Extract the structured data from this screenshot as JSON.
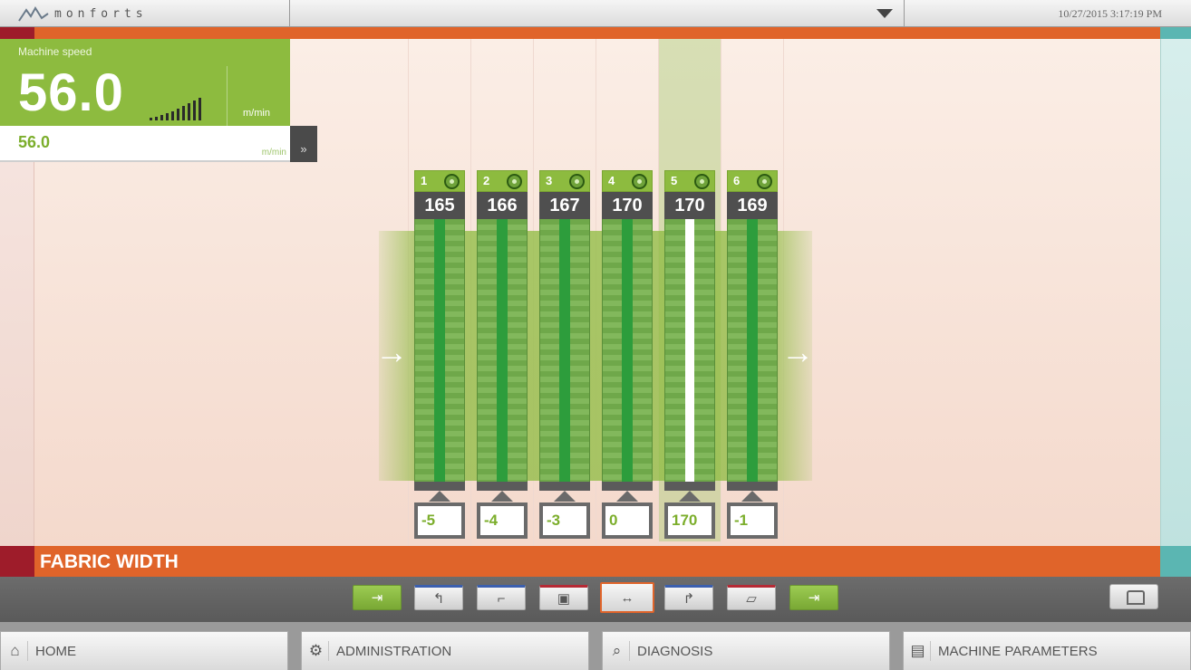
{
  "header": {
    "brand": "monforts",
    "datetime": "10/27/2015 3:17:19 PM"
  },
  "speed": {
    "label": "Machine speed",
    "value": "56.0",
    "unit": "m/min",
    "setpoint": "56.0",
    "setpoint_unit": "m/min",
    "go_label": "»"
  },
  "zones": [
    {
      "num": "1",
      "temp": "165",
      "offset": "-5",
      "active": false
    },
    {
      "num": "2",
      "temp": "166",
      "offset": "-4",
      "active": false
    },
    {
      "num": "3",
      "temp": "167",
      "offset": "-3",
      "active": false
    },
    {
      "num": "4",
      "temp": "170",
      "offset": "0",
      "active": false
    },
    {
      "num": "5",
      "temp": "170",
      "offset": "170",
      "active": true
    },
    {
      "num": "6",
      "temp": "169",
      "offset": "-1",
      "active": false
    }
  ],
  "section": {
    "title": "FABRIC WIDTH"
  },
  "toolbar": [
    {
      "icon": "⇥",
      "style": "green"
    },
    {
      "icon": "↰",
      "style": "grey blue-top"
    },
    {
      "icon": "⌐",
      "style": "grey blue-top"
    },
    {
      "icon": "▣",
      "style": "grey red-top"
    },
    {
      "icon": "↔",
      "style": "grey selected"
    },
    {
      "icon": "↱",
      "style": "grey blue-top"
    },
    {
      "icon": "▱",
      "style": "grey red-top"
    },
    {
      "icon": "⇥",
      "style": "green"
    }
  ],
  "nav": [
    {
      "label": "HOME",
      "icon": "⌂"
    },
    {
      "label": "ADMINISTRATION",
      "icon": "⚙"
    },
    {
      "label": "DIAGNOSIS",
      "icon": "⌕"
    },
    {
      "label": "MACHINE PARAMETERS",
      "icon": "▤"
    }
  ],
  "colors": {
    "accent_orange": "#e0642a",
    "accent_green": "#8dbb3f",
    "accent_red": "#9e1c2a",
    "accent_teal": "#5bb6b2"
  }
}
